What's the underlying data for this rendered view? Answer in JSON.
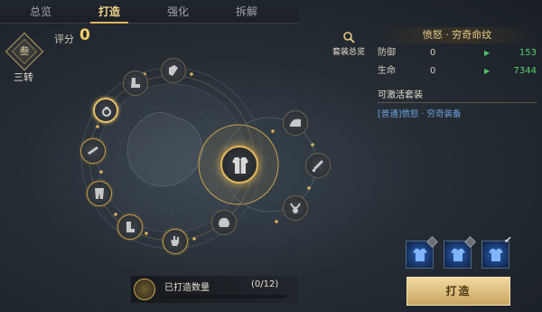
{
  "tabs": [
    {
      "label": "总览",
      "active": false
    },
    {
      "label": "打造",
      "active": true
    },
    {
      "label": "强化",
      "active": false
    },
    {
      "label": "拆解",
      "active": false
    }
  ],
  "rank": {
    "glyph": "叁",
    "label": "三转"
  },
  "score": {
    "label": "评分",
    "value": "0"
  },
  "suit_overview": {
    "label": "套装总览",
    "icon": "search-icon"
  },
  "panel": {
    "title": "愤怒 · 穷奇命纹",
    "stats": [
      {
        "name": "防御",
        "current": "0",
        "next": "153"
      },
      {
        "name": "生命",
        "current": "0",
        "next": "7344"
      }
    ],
    "set_title": "可激活套装",
    "set_item": "[普通]愤怒 · 穷奇装备"
  },
  "progress": {
    "label": "已打造数量",
    "count": "(0/12)",
    "fraction": 0
  },
  "forge_button": {
    "label": "打造"
  },
  "colors": {
    "accent": "#e3b85a",
    "stat_up": "#58d070",
    "set_link": "#6fa3e0",
    "gem": "#2a62b8"
  }
}
